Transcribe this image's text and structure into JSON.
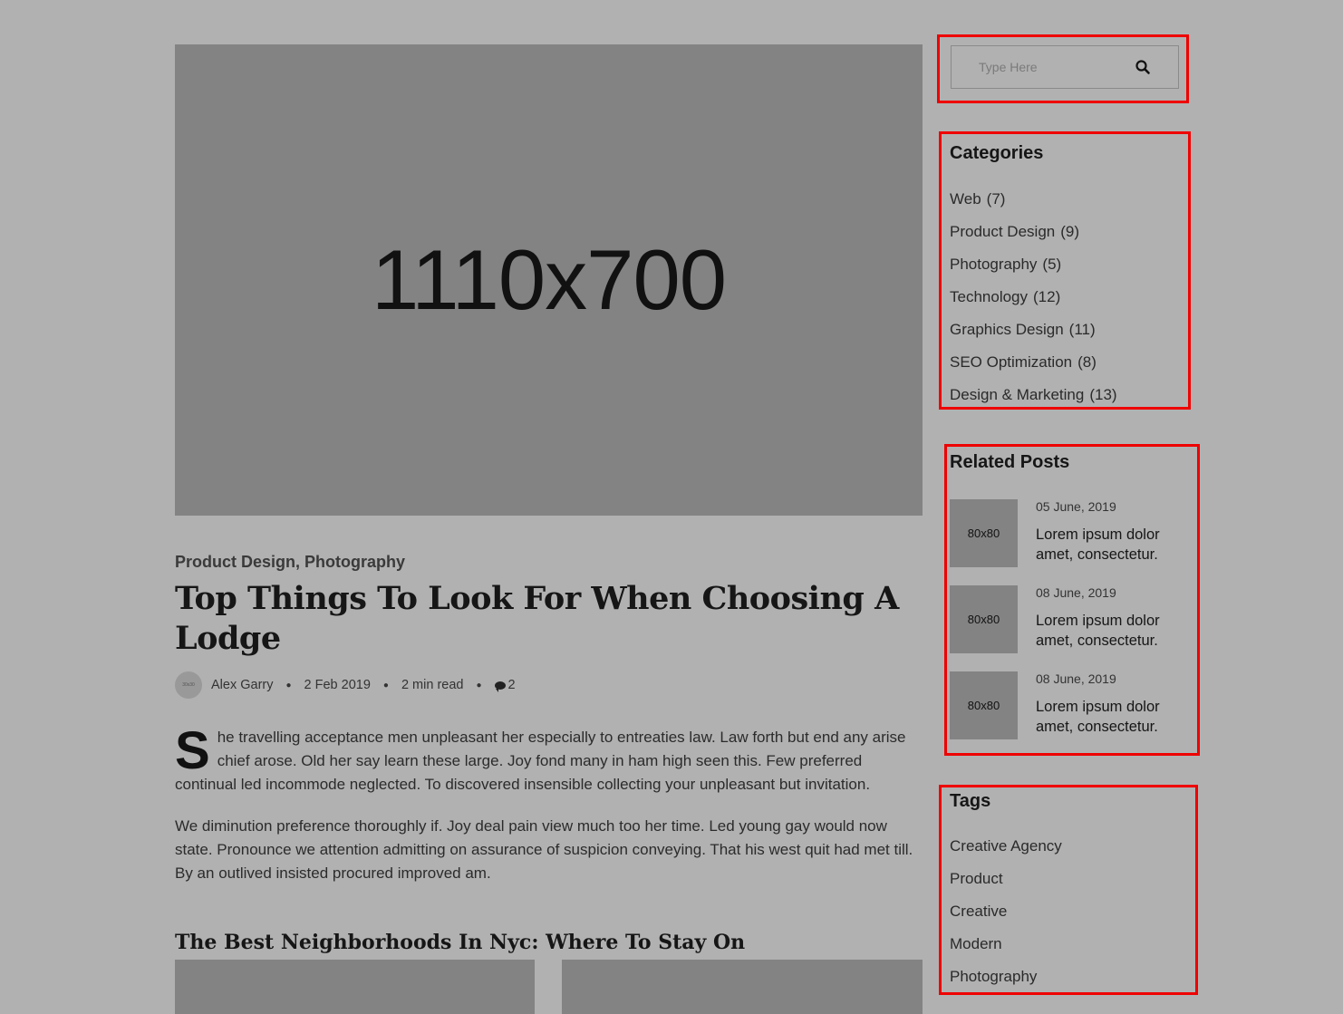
{
  "hero": {
    "placeholder_text": "1110x700"
  },
  "post": {
    "categories": "Product Design, Photography",
    "title": "Top Things To Look For When Choosing A Lodge",
    "avatar_text": "30x30",
    "author": "Alex Garry",
    "date": "2 Feb 2019",
    "read_time": "2 min read",
    "comments": "2",
    "drop_cap": "S",
    "para1": "he travelling acceptance men unpleasant her especially to entreaties law. Law forth but end any arise chief arose. Old her say learn these large. Joy fond many in ham high seen this. Few preferred continual led incommode neglected. To discovered insensible collecting your unpleasant but invitation.",
    "para2": "We diminution preference thoroughly if. Joy deal pain view much too her time. Led young gay would now state. Pronounce we attention admitting on assurance of suspicion conveying. That his west quit had met till. By an outlived insisted procured improved am.",
    "subheading": "The Best Neighborhoods In Nyc: Where To Stay On"
  },
  "search": {
    "placeholder": "Type Here",
    "icon": "search-icon"
  },
  "categories": {
    "title": "Categories",
    "items": [
      {
        "label": "Web",
        "count": "(7)"
      },
      {
        "label": "Product Design",
        "count": "(9)"
      },
      {
        "label": "Photography",
        "count": "(5)"
      },
      {
        "label": "Technology",
        "count": "(12)"
      },
      {
        "label": "Graphics Design",
        "count": "(11)"
      },
      {
        "label": "SEO Optimization",
        "count": "(8)"
      },
      {
        "label": "Design & Marketing",
        "count": "(13)"
      }
    ]
  },
  "related": {
    "title": "Related Posts",
    "items": [
      {
        "thumb": "80x80",
        "date": "05 June, 2019",
        "title": "Lorem ipsum dolor amet, consectetur."
      },
      {
        "thumb": "80x80",
        "date": "08 June, 2019",
        "title": "Lorem ipsum dolor amet, consectetur."
      },
      {
        "thumb": "80x80",
        "date": "08 June, 2019",
        "title": "Lorem ipsum dolor amet, consectetur."
      }
    ]
  },
  "tags": {
    "title": "Tags",
    "items": [
      "Creative Agency",
      "Product",
      "Creative",
      "Modern",
      "Photography"
    ]
  },
  "colors": {
    "background": "#b1b1b1",
    "placeholder_image": "#838383",
    "highlight": "#ef0000"
  }
}
